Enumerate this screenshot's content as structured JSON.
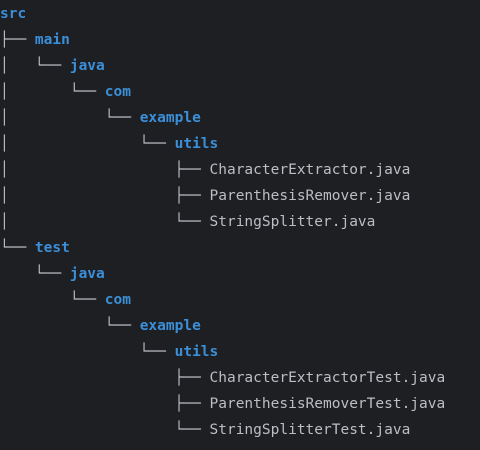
{
  "tree": {
    "rows": [
      {
        "prefix": "",
        "name": "src",
        "type": "folder"
      },
      {
        "prefix": "├── ",
        "name": "main",
        "type": "folder"
      },
      {
        "prefix": "│   └── ",
        "name": "java",
        "type": "folder"
      },
      {
        "prefix": "│       └── ",
        "name": "com",
        "type": "folder"
      },
      {
        "prefix": "│           └── ",
        "name": "example",
        "type": "folder"
      },
      {
        "prefix": "│               └── ",
        "name": "utils",
        "type": "folder"
      },
      {
        "prefix": "│                   ├── ",
        "name": "CharacterExtractor.java",
        "type": "file"
      },
      {
        "prefix": "│                   ├── ",
        "name": "ParenthesisRemover.java",
        "type": "file"
      },
      {
        "prefix": "│                   └── ",
        "name": "StringSplitter.java",
        "type": "file"
      },
      {
        "prefix": "└── ",
        "name": "test",
        "type": "folder"
      },
      {
        "prefix": "    └── ",
        "name": "java",
        "type": "folder"
      },
      {
        "prefix": "        └── ",
        "name": "com",
        "type": "folder"
      },
      {
        "prefix": "            └── ",
        "name": "example",
        "type": "folder"
      },
      {
        "prefix": "                └── ",
        "name": "utils",
        "type": "folder"
      },
      {
        "prefix": "                    ├── ",
        "name": "CharacterExtractorTest.java",
        "type": "file"
      },
      {
        "prefix": "                    ├── ",
        "name": "ParenthesisRemoverTest.java",
        "type": "file"
      },
      {
        "prefix": "                    └── ",
        "name": "StringSplitterTest.java",
        "type": "file"
      }
    ]
  },
  "colors": {
    "background": "#1e1f22",
    "folder": "#3b8fd9",
    "file": "#bcbec4",
    "branch_lines": "#bcbec4"
  }
}
